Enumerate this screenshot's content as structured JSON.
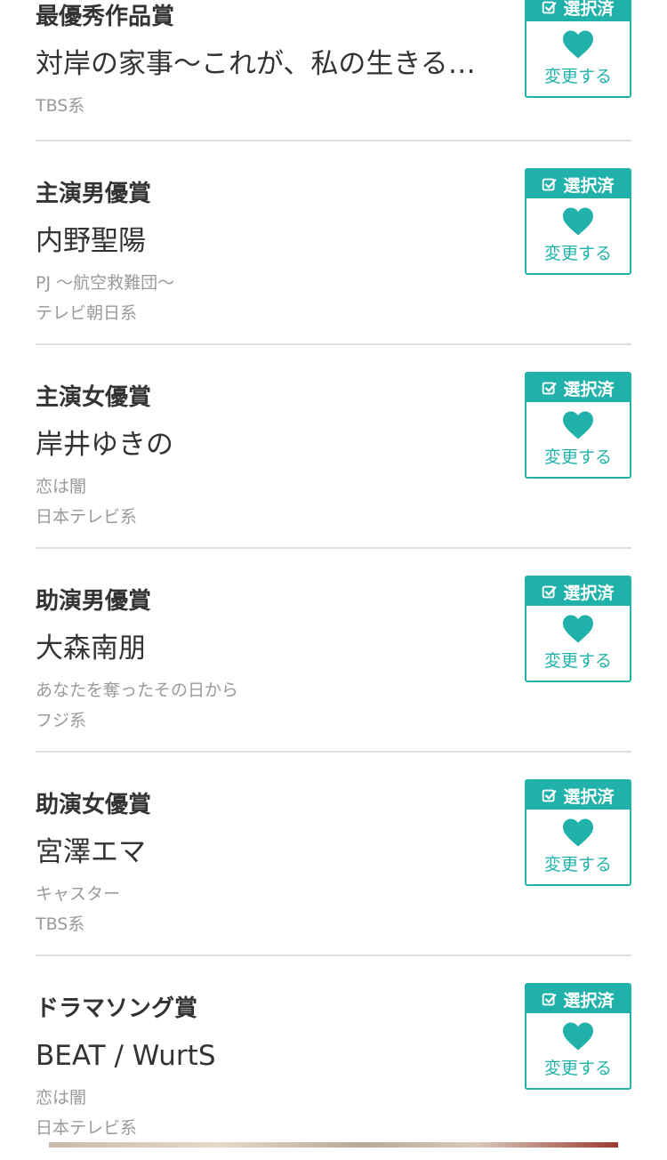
{
  "theme": {
    "accent": "#20b2aa",
    "divider": "#dedede",
    "text_main": "#333333",
    "text_sub": "#9a9a9a"
  },
  "awards": [
    {
      "title": "最優秀作品賞",
      "nominee": "対岸の家事〜これが、私の生きる…",
      "sub": [
        "TBS系"
      ],
      "status_label": "選択済",
      "change_label": "変更する"
    },
    {
      "title": "主演男優賞",
      "nominee": "内野聖陽",
      "sub": [
        "PJ 〜航空救難団〜",
        "テレビ朝日系"
      ],
      "status_label": "選択済",
      "change_label": "変更する"
    },
    {
      "title": "主演女優賞",
      "nominee": "岸井ゆきの",
      "sub": [
        "恋は闇",
        "日本テレビ系"
      ],
      "status_label": "選択済",
      "change_label": "変更する"
    },
    {
      "title": "助演男優賞",
      "nominee": "大森南朋",
      "sub": [
        "あなたを奪ったその日から",
        "フジ系"
      ],
      "status_label": "選択済",
      "change_label": "変更する"
    },
    {
      "title": "助演女優賞",
      "nominee": "宮澤エマ",
      "sub": [
        "キャスター",
        "TBS系"
      ],
      "status_label": "選択済",
      "change_label": "変更する"
    },
    {
      "title": "ドラマソング賞",
      "nominee": "BEAT / WurtS",
      "sub": [
        "恋は闇",
        "日本テレビ系"
      ],
      "status_label": "選択済",
      "change_label": "変更する"
    }
  ],
  "icons": {
    "check": "checkbox-check-icon",
    "heart": "heart-icon"
  }
}
